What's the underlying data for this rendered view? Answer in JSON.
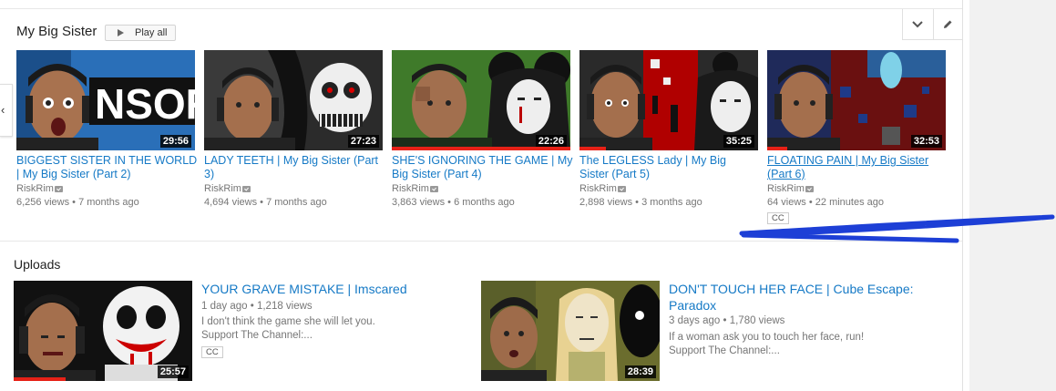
{
  "shelf": {
    "title": "My Big Sister",
    "play_all_label": "Play all",
    "expand_icon": "chevron-down-icon",
    "edit_icon": "pencil-icon",
    "videos": [
      {
        "title_line1": "BIGGEST SISTER IN THE WORLD",
        "title_line2": "| My Big Sister (Part 2)",
        "duration": "29:56",
        "channel": "RiskRim",
        "views": "6,256 views",
        "age": "7 months ago",
        "watched": 0
      },
      {
        "title_line1": "LADY TEETH | My Big Sister (Part",
        "title_line2": "3)",
        "duration": "27:23",
        "channel": "RiskRim",
        "views": "4,694 views",
        "age": "7 months ago",
        "watched": 0
      },
      {
        "title_line1": "SHE'S IGNORING THE GAME | My",
        "title_line2": "Big Sister (Part 4)",
        "duration": "22:26",
        "channel": "RiskRim",
        "views": "3,863 views",
        "age": "6 months ago",
        "watched": 1.0
      },
      {
        "title_line1": "The LEGLESS Lady | My Big",
        "title_line2": "Sister (Part 5)",
        "duration": "35:25",
        "channel": "RiskRim",
        "views": "2,898 views",
        "age": "3 months ago",
        "watched": 0.15
      },
      {
        "title_line1": "FLOATING PAIN | My Big Sister",
        "title_line2": "(Part 6)",
        "duration": "32:53",
        "channel": "RiskRim",
        "views": "64 views",
        "age": "22 minutes ago",
        "watched": 0.11,
        "cc": "CC"
      }
    ]
  },
  "uploads": {
    "title": "Uploads",
    "videos": [
      {
        "title_line1": "YOUR GRAVE MISTAKE | Imscared",
        "title_line2": "",
        "age": "1 day ago",
        "views": "1,218 views",
        "desc_line1": "I don't think the game she will let you.",
        "desc_line2": "Support The Channel:...",
        "duration": "25:57",
        "watched": 0.29,
        "cc": "CC"
      },
      {
        "title_line1": "DON'T TOUCH HER FACE | Cube Escape:",
        "title_line2": "Paradox",
        "age": "3 days ago",
        "views": "1,780 views",
        "desc_line1": "If a woman ask you to touch her face, run!",
        "desc_line2": "Support The Channel:...",
        "duration": "28:39",
        "watched": 0
      }
    ]
  },
  "separator": "•",
  "colors": {
    "link": "#167ac6",
    "progress": "#e62117",
    "annotation": "#1d3fd6"
  }
}
